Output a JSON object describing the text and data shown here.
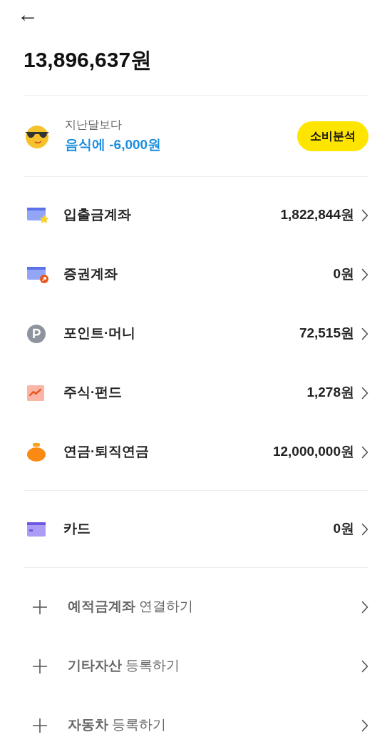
{
  "header": {
    "back": "←"
  },
  "total": "13,896,637원",
  "comparison": {
    "caption": "지난달보다",
    "detail": "음식에 -6,000원",
    "button": "소비분석"
  },
  "assets": [
    {
      "kind": "deposit",
      "label": "입출금계좌",
      "amount": "1,822,844원"
    },
    {
      "kind": "securities",
      "label": "증권계좌",
      "amount": "0원"
    },
    {
      "kind": "point",
      "label": "포인트·머니",
      "amount": "72,515원"
    },
    {
      "kind": "stock",
      "label": "주식·펀드",
      "amount": "1,278원"
    },
    {
      "kind": "pension",
      "label": "연금·퇴직연금",
      "amount": "12,000,000원"
    }
  ],
  "cards": [
    {
      "kind": "card",
      "label": "카드",
      "amount": "0원"
    }
  ],
  "add_items": [
    {
      "label": "**예적금계좌** 연결하기"
    },
    {
      "label": "**기타자산** 등록하기"
    },
    {
      "label": "**자동차** 등록하기"
    }
  ]
}
